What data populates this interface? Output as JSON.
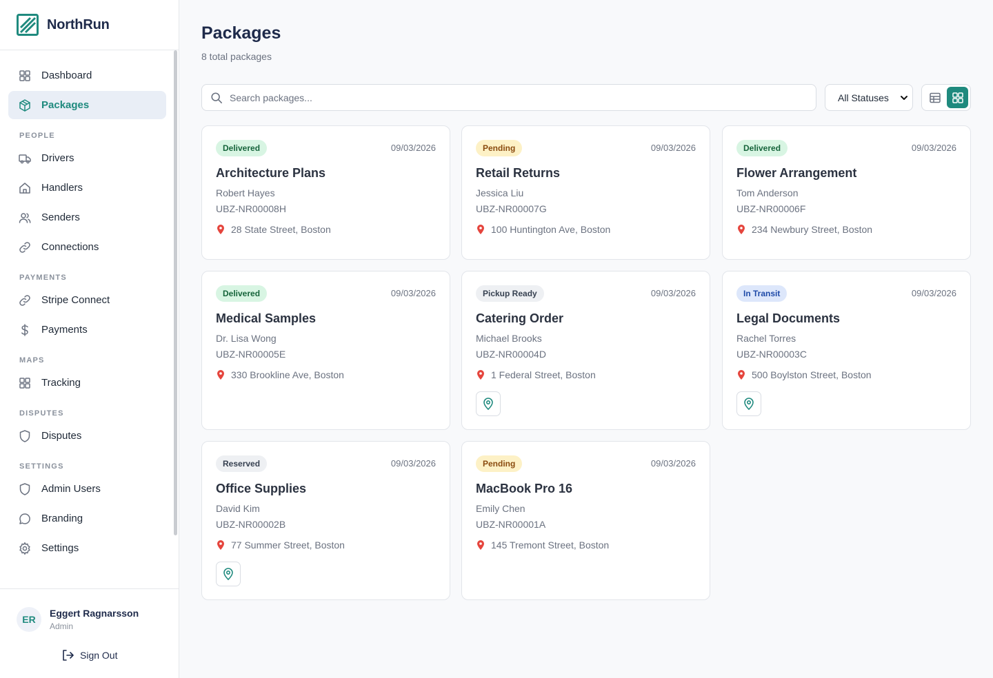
{
  "app": {
    "name": "NorthRun"
  },
  "sidebar": {
    "top_items": [
      {
        "label": "Dashboard",
        "icon": "dashboard-icon"
      },
      {
        "label": "Packages",
        "icon": "package-icon",
        "active": true
      }
    ],
    "sections": [
      {
        "title": "PEOPLE",
        "items": [
          {
            "label": "Drivers",
            "icon": "truck-icon"
          },
          {
            "label": "Handlers",
            "icon": "home-icon"
          },
          {
            "label": "Senders",
            "icon": "users-icon"
          },
          {
            "label": "Connections",
            "icon": "link-icon"
          }
        ]
      },
      {
        "title": "PAYMENTS",
        "items": [
          {
            "label": "Stripe Connect",
            "icon": "link-icon"
          },
          {
            "label": "Payments",
            "icon": "dollar-icon"
          }
        ]
      },
      {
        "title": "MAPS",
        "items": [
          {
            "label": "Tracking",
            "icon": "grid-icon"
          }
        ]
      },
      {
        "title": "DISPUTES",
        "items": [
          {
            "label": "Disputes",
            "icon": "shield-icon"
          }
        ]
      },
      {
        "title": "SETTINGS",
        "items": [
          {
            "label": "Admin Users",
            "icon": "shield-icon"
          },
          {
            "label": "Branding",
            "icon": "chat-bubble-icon"
          },
          {
            "label": "Settings",
            "icon": "gear-icon"
          }
        ]
      }
    ]
  },
  "user": {
    "initials": "ER",
    "name": "Eggert Ragnarsson",
    "role": "Admin",
    "signout_label": "Sign Out"
  },
  "page": {
    "title": "Packages",
    "subtitle": "8 total packages"
  },
  "toolbar": {
    "search_placeholder": "Search packages...",
    "status_filter": "All Statuses",
    "view_mode": "grid"
  },
  "colors": {
    "accent": "#1f8a7e",
    "brand_text": "#1e2a4a"
  },
  "packages": [
    {
      "status": "Delivered",
      "status_kind": "delivered",
      "date": "09/03/2026",
      "title": "Architecture Plans",
      "person": "Robert Hayes",
      "code": "UBZ-NR00008H",
      "address": "28 State Street, Boston",
      "has_location": false
    },
    {
      "status": "Pending",
      "status_kind": "pending",
      "date": "09/03/2026",
      "title": "Retail Returns",
      "person": "Jessica Liu",
      "code": "UBZ-NR00007G",
      "address": "100 Huntington Ave, Boston",
      "has_location": false
    },
    {
      "status": "Delivered",
      "status_kind": "delivered",
      "date": "09/03/2026",
      "title": "Flower Arrangement",
      "person": "Tom Anderson",
      "code": "UBZ-NR00006F",
      "address": "234 Newbury Street, Boston",
      "has_location": false
    },
    {
      "status": "Delivered",
      "status_kind": "delivered",
      "date": "09/03/2026",
      "title": "Medical Samples",
      "person": "Dr. Lisa Wong",
      "code": "UBZ-NR00005E",
      "address": "330 Brookline Ave, Boston",
      "has_location": false
    },
    {
      "status": "Pickup Ready",
      "status_kind": "pickup",
      "date": "09/03/2026",
      "title": "Catering Order",
      "person": "Michael Brooks",
      "code": "UBZ-NR00004D",
      "address": "1 Federal Street, Boston",
      "has_location": true
    },
    {
      "status": "In Transit",
      "status_kind": "transit",
      "date": "09/03/2026",
      "title": "Legal Documents",
      "person": "Rachel Torres",
      "code": "UBZ-NR00003C",
      "address": "500 Boylston Street, Boston",
      "has_location": true
    },
    {
      "status": "Reserved",
      "status_kind": "reserved",
      "date": "09/03/2026",
      "title": "Office Supplies",
      "person": "David Kim",
      "code": "UBZ-NR00002B",
      "address": "77 Summer Street, Boston",
      "has_location": true
    },
    {
      "status": "Pending",
      "status_kind": "pending",
      "date": "09/03/2026",
      "title": "MacBook Pro 16",
      "person": "Emily Chen",
      "code": "UBZ-NR00001A",
      "address": "145 Tremont Street, Boston",
      "has_location": false
    }
  ]
}
